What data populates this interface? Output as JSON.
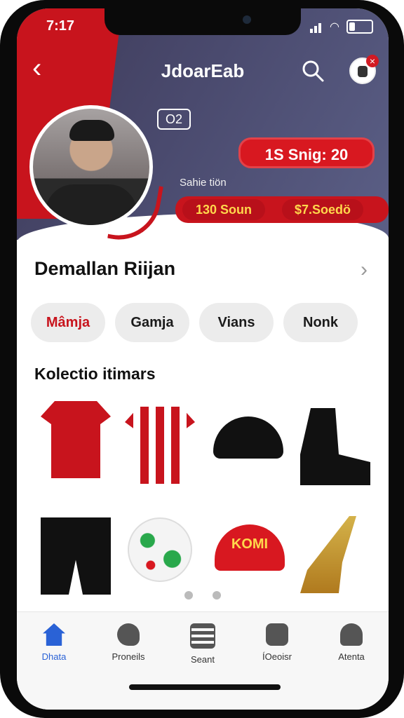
{
  "status": {
    "time": "7:17"
  },
  "header": {
    "title": "JdoarEab",
    "tag": "O2",
    "stat_main": "1S Snig: 20",
    "subtitle": "Sahie tiön",
    "stat_a": "130 Soun",
    "stat_b": "$7.Soedö"
  },
  "section": {
    "title": "Demallan Riijan"
  },
  "chips": [
    "Mâmja",
    "Gamja",
    "Vians",
    "Nonk"
  ],
  "collection": {
    "title": "Kolectio itimars",
    "badge_text": "KOMI"
  },
  "tabs": [
    {
      "label": "Dhata",
      "icon": "home-icon"
    },
    {
      "label": "Proneils",
      "icon": "heart-search-icon"
    },
    {
      "label": "Seant",
      "icon": "list-icon"
    },
    {
      "label": "ÍOeoisr",
      "icon": "camera-icon"
    },
    {
      "label": "Atenta",
      "icon": "user-icon"
    }
  ]
}
